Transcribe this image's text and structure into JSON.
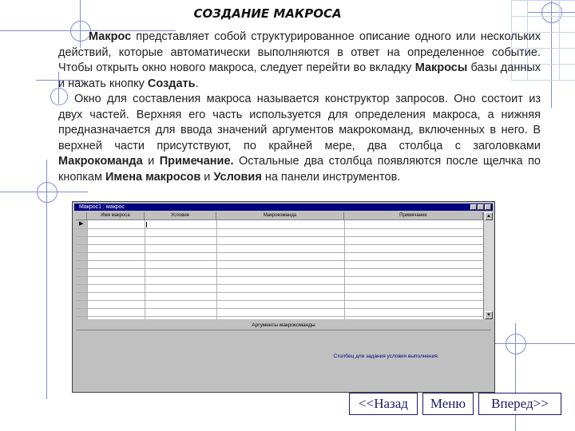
{
  "slide": {
    "title": "СОЗДАНИЕ МАКРОСА",
    "para1": {
      "t1": "Макрос",
      "t2": " представляет собой структурированное описание одного или нескольких действий, которые автоматически выполняются в ответ на определенное событие. Чтобы открыть окно нового макроса, следует перейти во вкладку ",
      "t3": "Макросы",
      "t4": " базы данных и нажать кнопку ",
      "t5": "Создать",
      "t6": "."
    },
    "para2": {
      "t1": "Окно для составления макроса называется конструктор запросов. Оно состоит из двух частей. Верхняя его часть используется для определения макроса, а нижняя предназначается для ввода значений аргументов макрокоманд, включенных в него. В верхней части присутствуют, по крайней мере, два столбца с заголовками ",
      "t2": "Макрокоманда",
      "t3": " и ",
      "t4": "Примечание.",
      "t5": " Остальные два столбца появляются после щелчка по кнопкам ",
      "t6": "Имена макросов",
      "t7": " и ",
      "t8": "Условия",
      "t9": " на панели инструментов."
    }
  },
  "macro_window": {
    "title": "Макрос1 : макрос",
    "columns": [
      "Имя макроса",
      "Условие",
      "Макрокоманда",
      "Примечание"
    ],
    "row_pointer": "▶",
    "args_header": "Аргументы макрокоманды",
    "hint": "Столбец для задания условия выполнения."
  },
  "nav": {
    "back": "<<Назад",
    "menu": "Меню",
    "forward": "Вперед>>"
  }
}
